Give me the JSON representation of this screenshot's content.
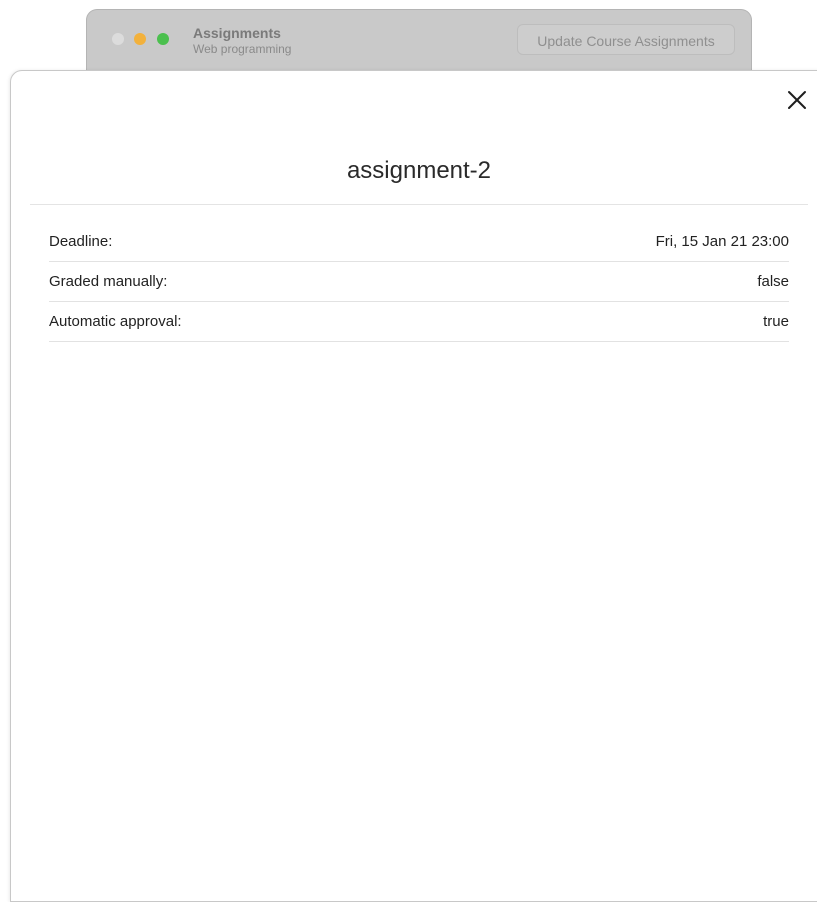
{
  "background_window": {
    "title": "Assignments",
    "subtitle": "Web programming",
    "update_button_label": "Update Course Assignments"
  },
  "sheet": {
    "title": "assignment-2",
    "close_icon": "close-icon",
    "details": [
      {
        "label": "Deadline:",
        "value": "Fri, 15 Jan 21 23:00"
      },
      {
        "label": "Graded manually:",
        "value": "false"
      },
      {
        "label": "Automatic approval:",
        "value": "true"
      }
    ]
  },
  "colors": {
    "traffic_close": "#dcdcdc",
    "traffic_minimize": "#f2b13c",
    "traffic_maximize": "#4bc04e"
  }
}
